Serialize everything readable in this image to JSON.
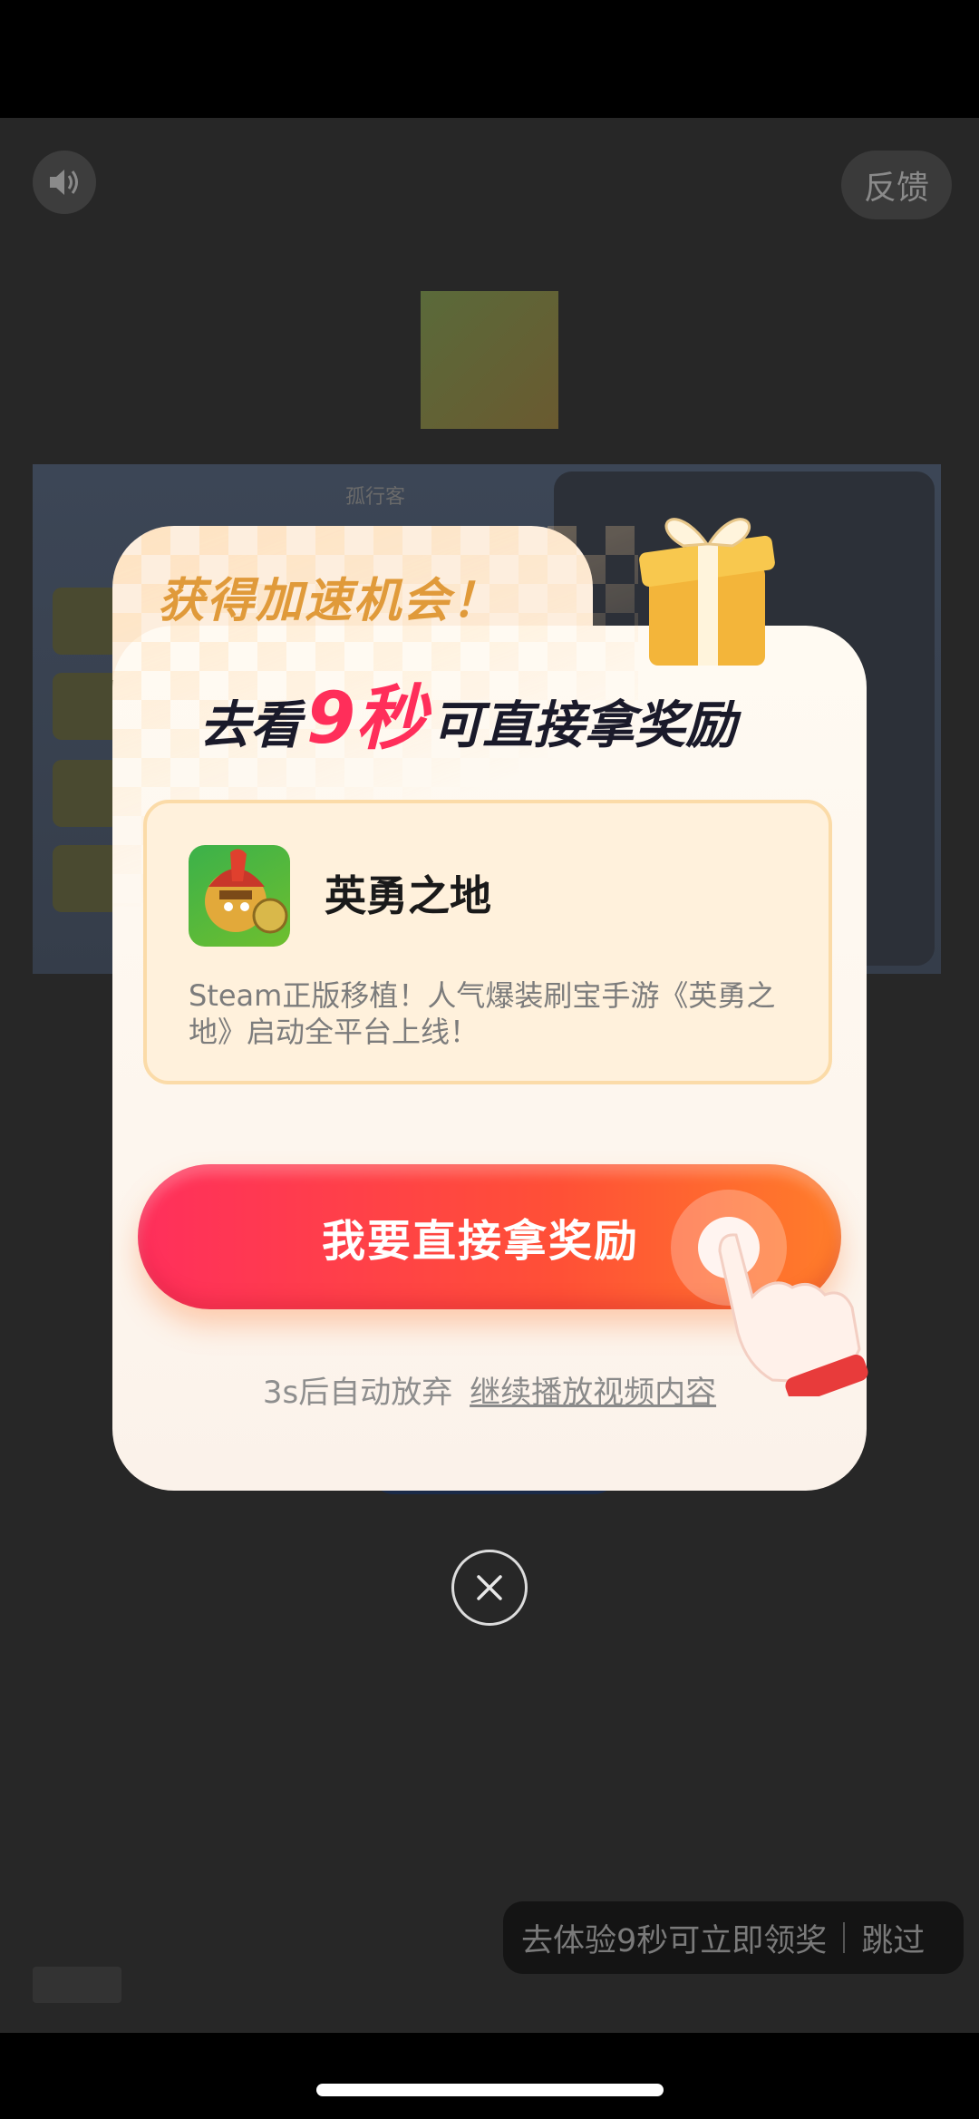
{
  "header": {
    "feedback_label": "反馈"
  },
  "background": {
    "game_title": "孤行客",
    "skip_tip": "去体验9秒可立即领奖",
    "skip_label": "跳过"
  },
  "modal": {
    "head_title": "获得加速机会！",
    "subtitle": {
      "prefix": "去看",
      "highlight": "9秒",
      "suffix": "可直接拿奖励"
    },
    "app": {
      "name": "英勇之地",
      "description": "Steam正版移植！人气爆装刷宝手游《英勇之地》启动全平台上线！"
    },
    "cta_label": "我要直接拿奖励",
    "auto_text": "3s后自动放弃",
    "continue_link": "继续播放视频内容"
  },
  "colors": {
    "accent": "#ff2e5a",
    "cta_start": "#ff2f5c",
    "cta_end": "#ff7d2a",
    "title_gold": "#e09a3a"
  },
  "icons": [
    "speaker-icon",
    "gift-icon",
    "hand-pointer-icon",
    "close-icon",
    "app-icon"
  ]
}
